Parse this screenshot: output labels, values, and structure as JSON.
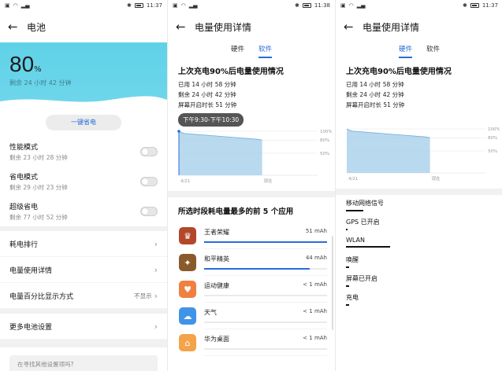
{
  "status_bar": {
    "time1": "11:37",
    "time2": "11:38",
    "time3": "11:37"
  },
  "panel1": {
    "title": "电池",
    "percent": "80",
    "percent_sym": "%",
    "remaining": "剩余 24 小时 42 分钟",
    "save_button": "一键省电",
    "modes": [
      {
        "title": "性能模式",
        "sub": "剩余 23 小时 28 分钟"
      },
      {
        "title": "省电模式",
        "sub": "剩余 29 小时 23 分钟"
      },
      {
        "title": "超级省电",
        "sub": "剩余 77 小时 52 分钟"
      }
    ],
    "nav": [
      {
        "label": "耗电排行"
      },
      {
        "label": "电量使用详情"
      },
      {
        "label": "电量百分比显示方式",
        "value": "不显示"
      },
      {
        "label": "更多电池设置"
      }
    ],
    "search_placeholder": "在寻找其他设置项吗?"
  },
  "panel2": {
    "title": "电量使用详情",
    "tab_hw": "硬件",
    "tab_sw": "软件",
    "heading": "上次充电90%后电量使用情况",
    "used": "已用 14 小时 58 分钟",
    "left": "剩余 24 小时 42 分钟",
    "screen": "屏幕开启时长 51 分钟",
    "tooltip": "下午9:30-下午10:30",
    "apps_title": "所选时段耗电量最多的前 5 个应用",
    "apps": [
      {
        "name": "王者荣耀",
        "value": "51 mAh",
        "color": "#b2472a",
        "fill": 1.0
      },
      {
        "name": "和平精英",
        "value": "44 mAh",
        "color": "#8a5a2b",
        "fill": 0.86
      },
      {
        "name": "运动健康",
        "value": "< 1 mAh",
        "color": "#f08040",
        "fill": 0.0
      },
      {
        "name": "天气",
        "value": "< 1 mAh",
        "color": "#3f94e8",
        "fill": 0.0
      },
      {
        "name": "华为桌面",
        "value": "< 1 mAh",
        "color": "#f3a34a",
        "fill": 0.0
      }
    ]
  },
  "panel3": {
    "title": "电量使用详情",
    "tab_hw": "硬件",
    "tab_sw": "软件",
    "heading": "上次充电90%后电量使用情况",
    "used": "已用 14 小时 58 分钟",
    "left": "剩余 24 小时 42 分钟",
    "screen": "屏幕开启时长 51 分钟",
    "hw_items": [
      {
        "label": "移动网络信号",
        "fill": 0.12
      },
      {
        "label": "GPS 已开启",
        "fill": 0.0
      },
      {
        "label": "WLAN",
        "fill": 0.3
      },
      {
        "label": "唤醒",
        "fill": 0.02
      },
      {
        "label": "屏幕已开启",
        "fill": 0.02
      },
      {
        "label": "充电",
        "fill": 0.02
      }
    ]
  },
  "chart_data": {
    "type": "area",
    "ytick_labels": [
      "100%",
      "80%",
      "50%"
    ],
    "xtick_labels": [
      "4/21",
      "现在"
    ],
    "x_hours": [
      0,
      0.3,
      1,
      2,
      3,
      4,
      5,
      6,
      7,
      8,
      9,
      10,
      11,
      12,
      13,
      14,
      15
    ],
    "y_percent": [
      100,
      98,
      95,
      94,
      93,
      92,
      91,
      90,
      89,
      88,
      87,
      86,
      85,
      84,
      83,
      82,
      80
    ],
    "highlight_color": "#2a6dd9",
    "fill_color": "#a8d0ea"
  }
}
